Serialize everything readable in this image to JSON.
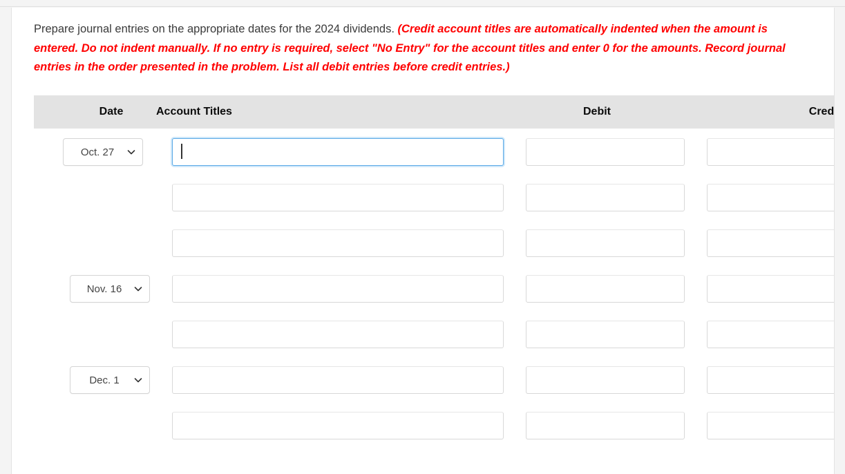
{
  "instructions": {
    "plain_text": "Prepare journal entries on the appropriate dates for the 2024 dividends. ",
    "emphasis_text": "(Credit account titles are automatically indented when the amount is entered. Do not indent manually. If no entry is required, select \"No Entry\" for the account titles and enter 0 for the amounts. Record journal entries in the order presented in the problem. List all debit entries before credit entries.)",
    "emphasis_color": "#ff0000"
  },
  "table": {
    "headers": {
      "date": "Date",
      "account_titles": "Account Titles",
      "debit": "Debit",
      "credit": "Credit"
    },
    "header_background": "#e3e3e3",
    "rows": [
      {
        "date_value": "Oct. 27",
        "has_date_select": true,
        "account_value": "",
        "account_focused": true,
        "debit_value": "",
        "credit_value": ""
      },
      {
        "date_value": "",
        "has_date_select": false,
        "account_value": "",
        "account_focused": false,
        "debit_value": "",
        "credit_value": ""
      },
      {
        "date_value": "",
        "has_date_select": false,
        "account_value": "",
        "account_focused": false,
        "debit_value": "",
        "credit_value": ""
      },
      {
        "date_value": "Nov. 16",
        "has_date_select": true,
        "account_value": "",
        "account_focused": false,
        "debit_value": "",
        "credit_value": ""
      },
      {
        "date_value": "",
        "has_date_select": false,
        "account_value": "",
        "account_focused": false,
        "debit_value": "",
        "credit_value": ""
      },
      {
        "date_value": "Dec. 1",
        "has_date_select": true,
        "account_value": "",
        "account_focused": false,
        "debit_value": "",
        "credit_value": ""
      },
      {
        "date_value": "",
        "has_date_select": false,
        "account_value": "",
        "account_focused": false,
        "debit_value": "",
        "credit_value": ""
      }
    ]
  },
  "icons": {
    "chevron_down": "chevron-down-icon"
  },
  "colors": {
    "focus_border": "#5aa9e6",
    "input_border": "#d8d8d8",
    "page_background": "#f4f4f4",
    "card_background": "#ffffff"
  }
}
